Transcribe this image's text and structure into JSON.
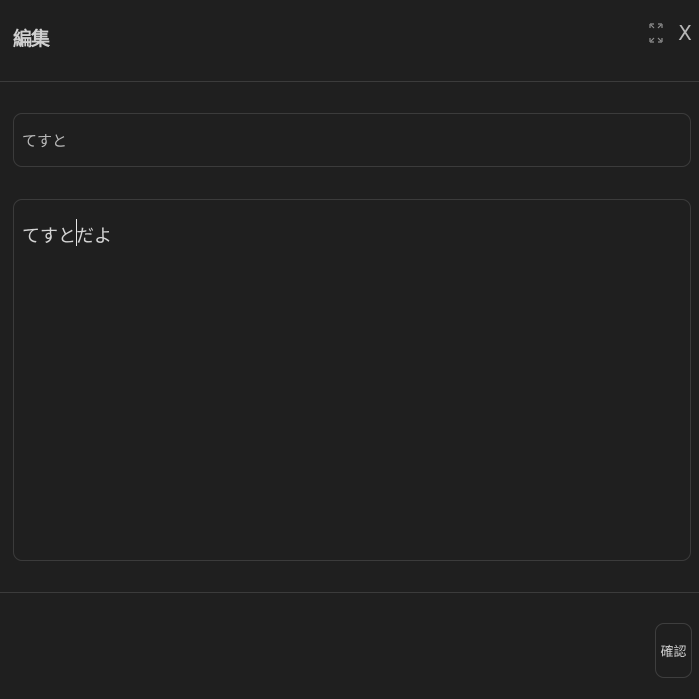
{
  "dialog": {
    "title": "編集",
    "expand_icon": "expand-icon",
    "close_label": "X"
  },
  "form": {
    "title_value": "てすと",
    "body_value": "てすとだよ"
  },
  "footer": {
    "confirm_label": "確認"
  },
  "colors": {
    "background": "#1f1f1f",
    "border": "#3b3b3b",
    "text": "#d7d7d7"
  }
}
